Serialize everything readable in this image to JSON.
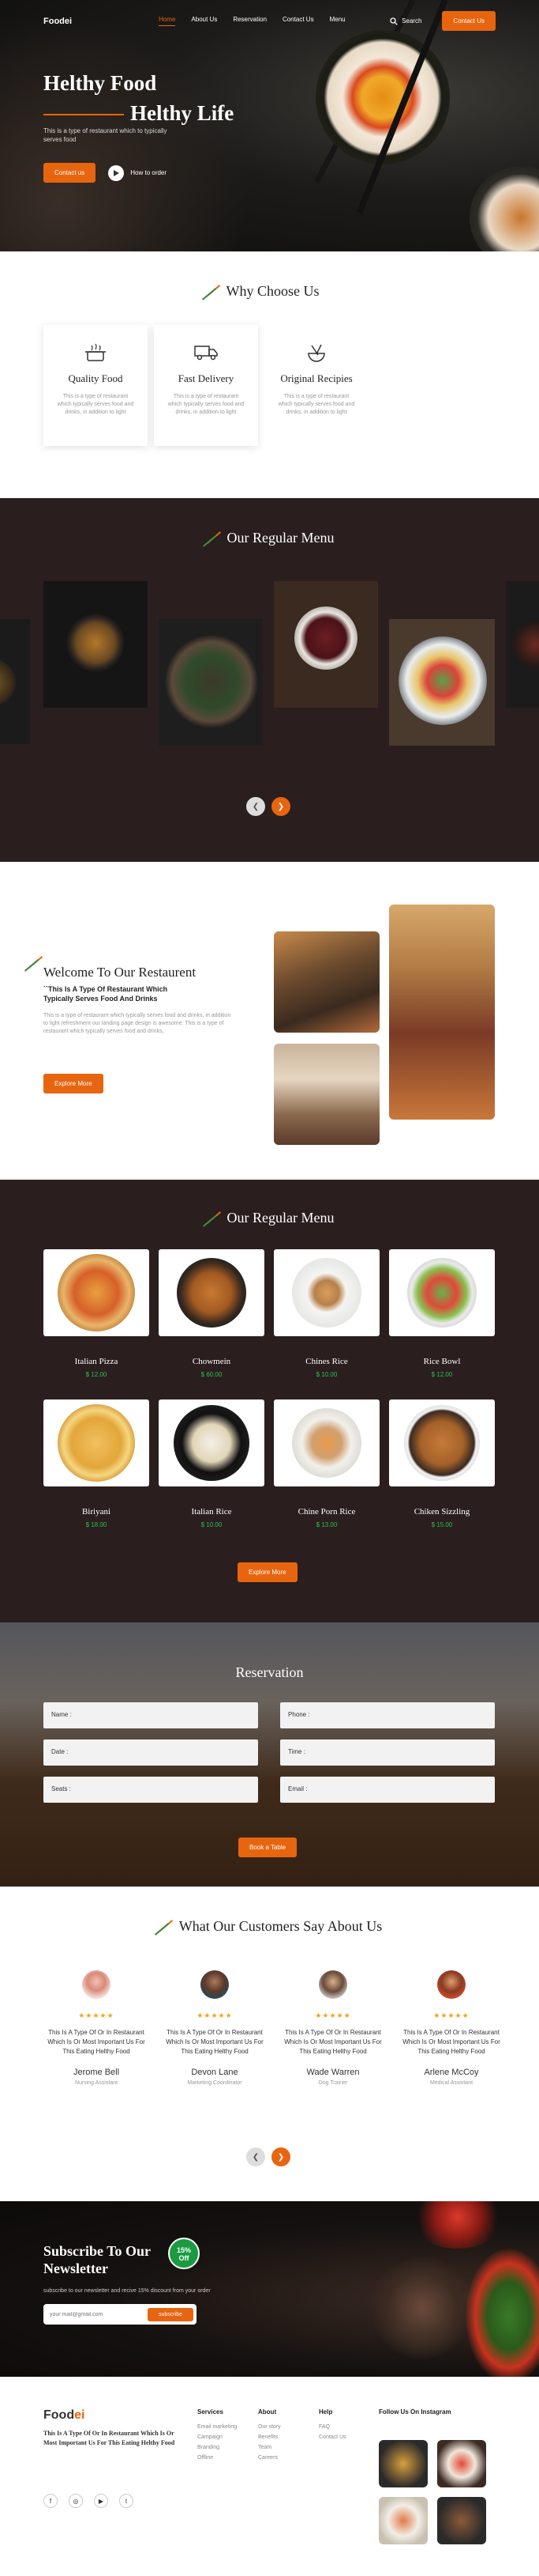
{
  "nav": {
    "logo_a": "Food",
    "logo_b": "ei",
    "links": [
      "Home",
      "About Us",
      "Reservation",
      "Contact Us",
      "Menu"
    ],
    "search_label": "Search",
    "contact_button": "Contact Us"
  },
  "hero": {
    "title_line1": "Helthy Food",
    "title_line2": "Helthy Life",
    "subtitle": "This is a type of restaurant which to typically serves food",
    "contact_button": "Contact us",
    "how_to_order": "How to order"
  },
  "why": {
    "title": "Why Choose Us",
    "cards": [
      {
        "title": "Quality Food",
        "text": "This is a type of restaurant which typically serves food and drinks, in addition to light",
        "icon": "cooking-pot-icon"
      },
      {
        "title": "Fast Delivery",
        "text": "This is a type of restaurant which typically serves food and drinks, in addition to light",
        "icon": "delivery-truck-icon"
      },
      {
        "title": "Original Recipies",
        "text": "This is a type of restaurant which typically serves food and drinks, in addition to light",
        "icon": "whisk-bowl-icon"
      }
    ]
  },
  "menu_carousel": {
    "title": "Our Regular Menu"
  },
  "welcome": {
    "title": "Welcome To Our Restaurent",
    "subtitle": "``This Is A Type Of Restaurant Which Typically Serves Food And Drinks",
    "text": "This is a type of restaurant which typically serves food and drinks, in addition to light refreshment our landing page design is awesome. This is a type of restaurant which typically serves food and drinks,",
    "button": "Explore More"
  },
  "menu_grid": {
    "title": "Our Regular Menu",
    "items": [
      {
        "name": "Italian Pizza",
        "price": "$ 12.00"
      },
      {
        "name": "Chowmein",
        "price": "$ 60.00"
      },
      {
        "name": "Chines Rice",
        "price": "$ 10.00"
      },
      {
        "name": "Rice Bowl",
        "price": "$ 12.00"
      },
      {
        "name": "Biriyani",
        "price": "$ 18.00"
      },
      {
        "name": "Italian Rice",
        "price": "$ 10.00"
      },
      {
        "name": "Chine Porn Rice",
        "price": "$ 13.00"
      },
      {
        "name": "Chiken Sizzling",
        "price": "$ 15.00"
      }
    ],
    "button": "Explore More"
  },
  "reservation": {
    "title": "Reservation",
    "fields": [
      "Name :",
      "Phone :",
      "Date :",
      "Time :",
      "Seats :",
      "Email :"
    ],
    "button": "Book a Table"
  },
  "testimonials": {
    "title": "What Our Customers Say About Us",
    "stars": "★★★★★",
    "items": [
      {
        "quote": "This Is A Type Of Or In Restaurant Which Is Or Most Important Us For This Eating Helthy Food",
        "name": "Jerome Bell",
        "role": "Nursing Assistant"
      },
      {
        "quote": "This Is A Type Of Or In Restaurant Which Is Or Most Important Us For This Eating Helthy Food",
        "name": "Devon Lane",
        "role": "Marketing Coordinator"
      },
      {
        "quote": "This Is A Type Of Or In Restaurant Which Is Or Most Important Us For This Eating Helthy Food",
        "name": "Wade Warren",
        "role": "Dog Trainer"
      },
      {
        "quote": "This Is A Type Of Or In Restaurant Which Is Or Most Important Us For This Eating Helthy Food",
        "name": "Arlene McCoy",
        "role": "Medical Assistant"
      }
    ]
  },
  "subscribe": {
    "title_line1": "Subscribe To Our",
    "title_line2": "Newsletter",
    "badge_line1": "15%",
    "badge_line2": "Off",
    "text": "subscribe to our newsletter and recive 15% discount from your order",
    "placeholder": "your mail@gmail.com",
    "button": "subscribe"
  },
  "footer": {
    "logo_a": "Food",
    "logo_b": "ei",
    "desc": "This Is A Type Of Or In Restaurant Which Is Or Most Important Us For This Eating Helthy Food",
    "services_title": "Services",
    "services": [
      "Email marketing",
      "Campaign",
      "Branding",
      "Offline"
    ],
    "about_title": "About",
    "about": [
      "Our story",
      "Benefits",
      "Team",
      "Careers"
    ],
    "help_title": "Help",
    "help": [
      "FAQ",
      "Contact Us"
    ],
    "instagram_title": "Follow Us On Instagram",
    "social": [
      "f",
      "◎",
      "▶",
      "t"
    ]
  },
  "colors": {
    "accent": "#e8650f",
    "dark_bg": "#2a1e1f",
    "price_green": "#2fbf4f",
    "star": "#f2a21b"
  }
}
